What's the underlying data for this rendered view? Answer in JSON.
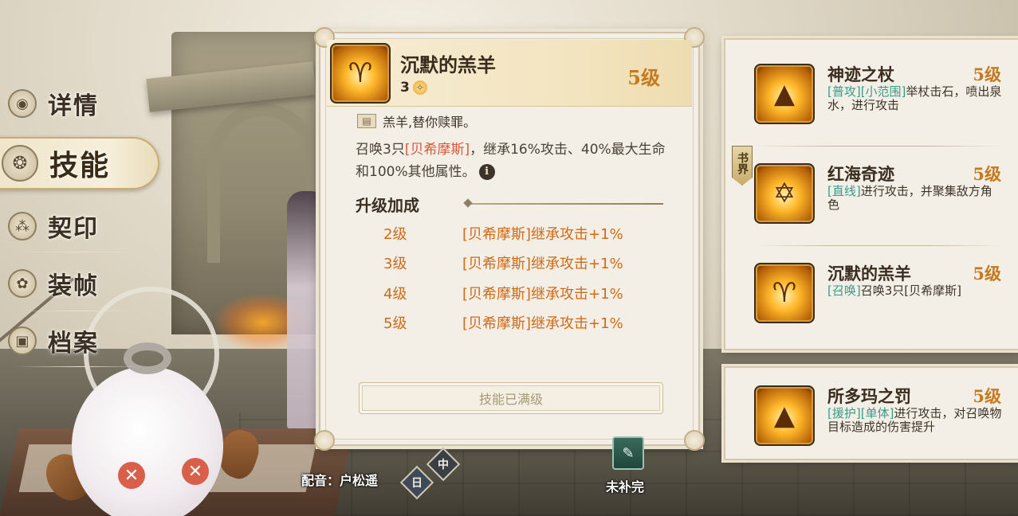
{
  "nav": {
    "items": [
      {
        "label": "详情",
        "icon": "eye-icon",
        "glyph": "◉",
        "active": false
      },
      {
        "label": "技能",
        "icon": "skill-swirl-icon",
        "glyph": "❂",
        "active": true
      },
      {
        "label": "契印",
        "icon": "seal-nodes-icon",
        "glyph": "⁂",
        "active": false
      },
      {
        "label": "装帧",
        "icon": "lotus-icon",
        "glyph": "✿",
        "active": false
      },
      {
        "label": "档案",
        "icon": "archive-icon",
        "glyph": "▣",
        "active": false
      }
    ]
  },
  "detail": {
    "icon_glyph": "♈",
    "title": "沉默的羔羊",
    "cost": "3",
    "cost_glyph": "✧",
    "level": "5级",
    "quote_glyph": "📖",
    "quote": "羔羊,替你赎罪。",
    "desc_prefix": "召唤3只",
    "desc_highlight": "[贝希摩斯]",
    "desc_suffix": "，继承16%攻击、40%最大生命和100%其他属性。",
    "info_glyph": "i",
    "upgrade_title": "升级加成",
    "upgrades": [
      {
        "level": "2级",
        "effect": "[贝希摩斯]继承攻击+1%"
      },
      {
        "level": "3级",
        "effect": "[贝希摩斯]继承攻击+1%"
      },
      {
        "level": "4级",
        "effect": "[贝希摩斯]继承攻击+1%"
      },
      {
        "level": "5级",
        "effect": "[贝希摩斯]继承攻击+1%"
      }
    ],
    "maxed_label": "技能已满级"
  },
  "skills": [
    {
      "name": "神迹之杖",
      "level": "5级",
      "glyph": "▲",
      "tags": "[普攻][小范围]",
      "text": "举杖击石，喷出泉水，进行攻击"
    },
    {
      "name": "红海奇迹",
      "level": "5级",
      "glyph": "✡",
      "tags": "[直线]",
      "text": "进行攻击，并聚集敌方角色"
    },
    {
      "name": "沉默的羔羊",
      "level": "5级",
      "glyph": "♈",
      "tags": "[召唤]",
      "text": "召唤3只[贝希摩斯]"
    },
    {
      "name": "所多玛之罚",
      "level": "5级",
      "glyph": "▲",
      "tags": "[援护][单体]",
      "text": "进行攻击，对召唤物目标造成的伤害提升"
    }
  ],
  "book_tab": "书界",
  "voice": {
    "label": "配音：户松遥",
    "lang_jp": "日",
    "lang_cn": "中"
  },
  "status": {
    "icon_glyph": "✎",
    "label": "未补完"
  },
  "colors": {
    "level_orange": "#c47a1e",
    "upgrade_orange": "#d06a16",
    "highlight_red": "#d4593a",
    "tag_teal": "#3a9a8a"
  }
}
